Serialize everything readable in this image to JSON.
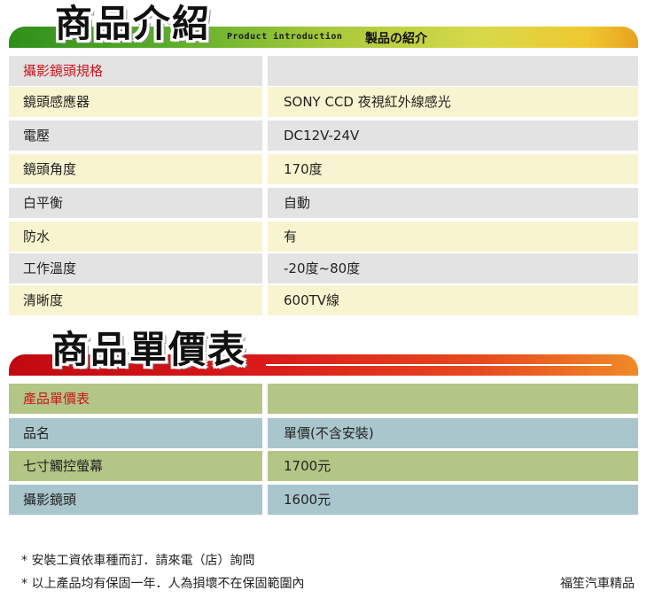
{
  "section1": {
    "title": "商品介紹",
    "subtitle_en": "Product introduction",
    "subtitle_jp": "製品の紹介"
  },
  "spec_table": {
    "header": [
      "攝影鏡頭規格",
      ""
    ],
    "rows": [
      {
        "label": "鏡頭感應器",
        "value": "SONY CCD 夜視紅外線感光"
      },
      {
        "label": "電壓",
        "value": "DC12V-24V"
      },
      {
        "label": "鏡頭角度",
        "value": "170度"
      },
      {
        "label": "白平衡",
        "value": "自動"
      },
      {
        "label": "防水",
        "value": "有"
      },
      {
        "label": "工作溫度",
        "value": "-20度~80度"
      },
      {
        "label": "清晰度",
        "value": "600TV線"
      }
    ]
  },
  "section2": {
    "title": "商品單價表"
  },
  "price_table": {
    "header": [
      "產品單價表",
      ""
    ],
    "rows": [
      {
        "label": "品名",
        "value": "單價(不含安裝)"
      },
      {
        "label": "七寸觸控螢幕",
        "value": "1700元"
      },
      {
        "label": "攝影鏡頭",
        "value": "1600元"
      }
    ]
  },
  "footer": {
    "notes": [
      "* 安裝工資依車種而訂．請來電（店）詢問",
      "* 以上產品均有保固一年．人為損壞不在保固範圍內"
    ],
    "brand": "福笙汽車精品"
  },
  "colors": {
    "accent_red": "#c8171f",
    "spec_gray": "#e3e3e3",
    "spec_light": "#f8f4cf",
    "price_green": "#b3c685",
    "price_blue": "#a9c6cc"
  }
}
